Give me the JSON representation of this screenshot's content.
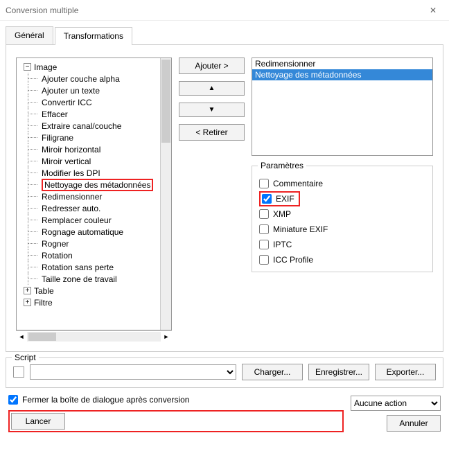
{
  "window": {
    "title": "Conversion multiple"
  },
  "tabs": {
    "general": "Général",
    "transformations": "Transformations"
  },
  "tree": {
    "group_image": "Image",
    "items": [
      "Ajouter couche alpha",
      "Ajouter un texte",
      "Convertir ICC",
      "Effacer",
      "Extraire canal/couche",
      "Filigrane",
      "Miroir horizontal",
      "Miroir vertical",
      "Modifier les DPI",
      "Nettoyage des métadonnées",
      "Redimensionner",
      "Redresser auto.",
      "Remplacer couleur",
      "Rognage automatique",
      "Rogner",
      "Rotation",
      "Rotation sans perte",
      "Taille zone de travail"
    ],
    "group_table": "Table",
    "group_filter": "Filtre"
  },
  "buttons": {
    "add": "Ajouter >",
    "remove": "< Retirer",
    "load": "Charger...",
    "save": "Enregistrer...",
    "export": "Exporter...",
    "launch": "Lancer",
    "cancel": "Annuler"
  },
  "listbox": {
    "items": [
      "Redimensionner",
      "Nettoyage des métadonnées"
    ],
    "selected_index": 1
  },
  "params": {
    "legend": "Paramètres",
    "options": [
      {
        "label": "Commentaire",
        "checked": false,
        "boxed": false
      },
      {
        "label": "EXIF",
        "checked": true,
        "boxed": true
      },
      {
        "label": "XMP",
        "checked": false,
        "boxed": false
      },
      {
        "label": "Miniature EXIF",
        "checked": false,
        "boxed": false
      },
      {
        "label": "IPTC",
        "checked": false,
        "boxed": false
      },
      {
        "label": "ICC Profile",
        "checked": false,
        "boxed": false
      }
    ]
  },
  "script": {
    "label": "Script"
  },
  "close_after": {
    "label": "Fermer la boîte de dialogue après conversion",
    "checked": true
  },
  "post_action": {
    "selected": "Aucune action"
  }
}
